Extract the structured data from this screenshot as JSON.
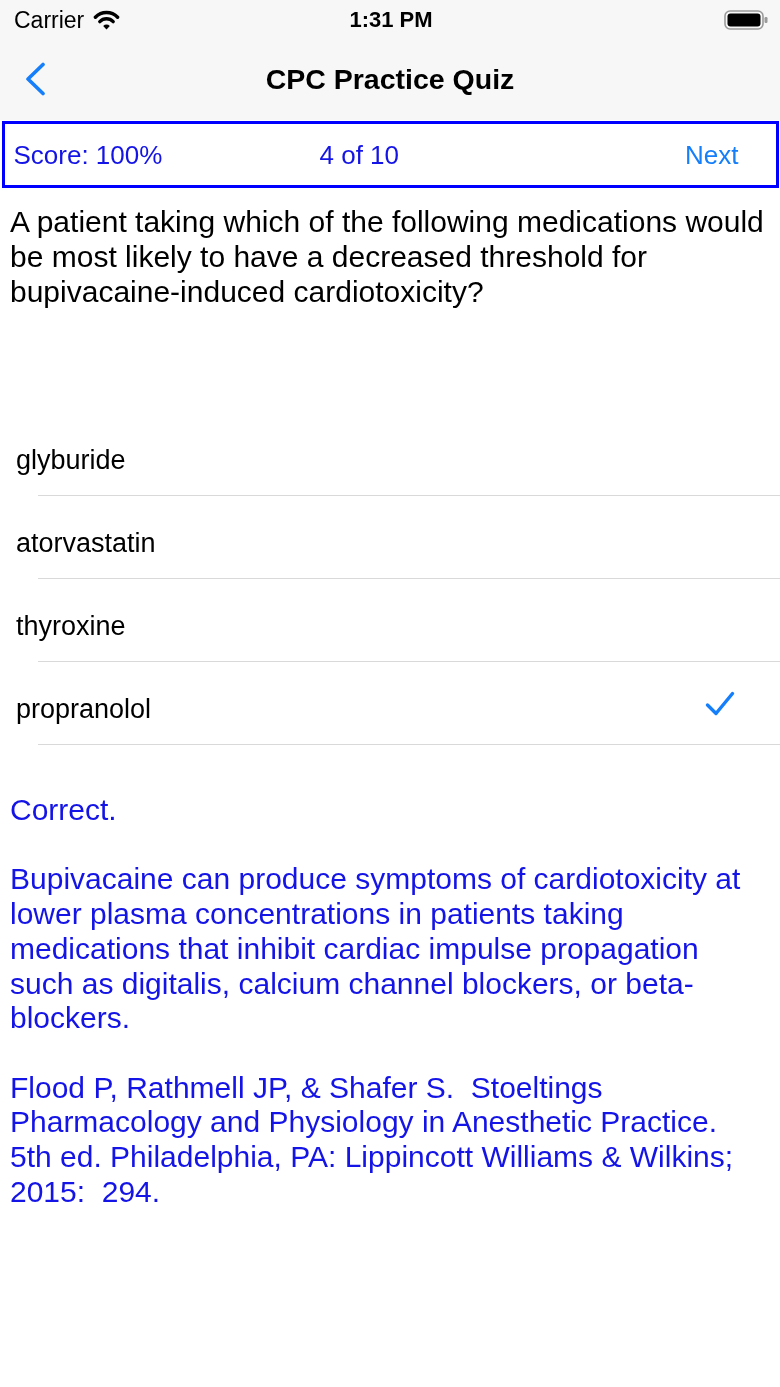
{
  "status_bar": {
    "carrier": "Carrier",
    "time": "1:31 PM"
  },
  "nav_bar": {
    "title": "CPC Practice Quiz"
  },
  "quiz_bar": {
    "score": "Score: 100%",
    "progress": "4 of 10",
    "next": "Next"
  },
  "question": "A patient taking which of the following medications would be most likely to have a decreased threshold for bupivacaine-induced cardiotoxicity?",
  "answers": [
    {
      "label": "glyburide",
      "selected": false
    },
    {
      "label": "atorvastatin",
      "selected": false
    },
    {
      "label": "thyroxine",
      "selected": false
    },
    {
      "label": "propranolol",
      "selected": true
    }
  ],
  "feedback": {
    "result": "Correct.",
    "explanation": "Bupivacaine can produce symptoms of cardiotoxicity at lower plasma concentrations in patients taking medications that inhibit cardiac impulse propagation such as digitalis, calcium channel blockers, or beta-blockers.",
    "reference": "Flood P, Rathmell JP, & Shafer S.  Stoeltings Pharmacology and Physiology in Anesthetic Practice. 5th ed. Philadelphia, PA: Lippincott Williams & Wilkins; 2015:  294."
  }
}
